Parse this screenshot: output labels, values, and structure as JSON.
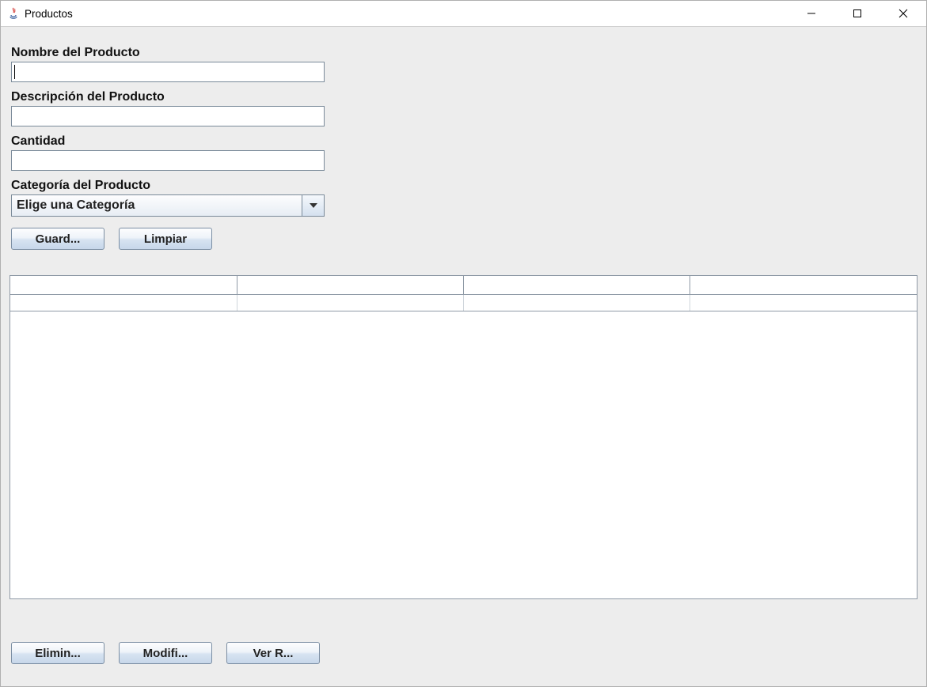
{
  "window": {
    "title": "Productos"
  },
  "form": {
    "nombre_label": "Nombre del Producto",
    "nombre_value": "",
    "descripcion_label": "Descripción del Producto",
    "descripcion_value": "",
    "cantidad_label": "Cantidad",
    "cantidad_value": "",
    "categoria_label": "Categoría del Producto",
    "categoria_selected": "Elige una Categoría"
  },
  "buttons": {
    "guardar": "Guard...",
    "limpiar": "Limpiar",
    "eliminar": "Elimin...",
    "modificar": "Modifi...",
    "ver_registros": "Ver R..."
  },
  "table": {
    "headers": [
      "",
      "",
      "",
      ""
    ],
    "rows": [
      [
        "",
        "",
        "",
        ""
      ]
    ]
  },
  "icons": {
    "java": "java-icon",
    "minimize": "minimize-icon",
    "maximize": "maximize-icon",
    "close": "close-icon",
    "dropdown": "chevron-down-icon"
  }
}
